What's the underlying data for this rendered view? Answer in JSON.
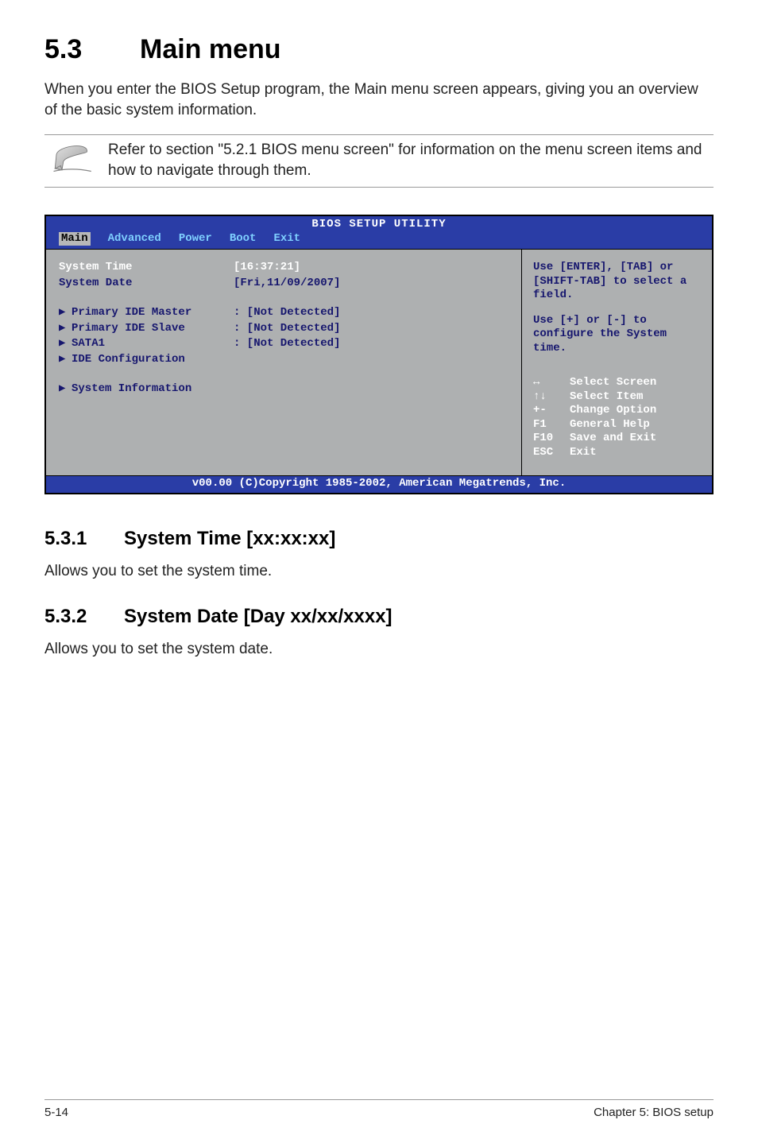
{
  "heading": {
    "number": "5.3",
    "title": "Main menu"
  },
  "intro": "When you enter the BIOS Setup program, the Main menu screen appears, giving you an overview of the basic system information.",
  "note": "Refer to section \"5.2.1  BIOS menu screen\" for information on the menu screen items and how to navigate through them.",
  "bios": {
    "title": "BIOS SETUP UTILITY",
    "tabs": [
      "Main",
      "Advanced",
      "Power",
      "Boot",
      "Exit"
    ],
    "selected_tab": "Main",
    "left": {
      "system_time_label": "System Time",
      "system_time_value": "[16:37:21]",
      "system_date_label": "System Date",
      "system_date_value": "[Fri,11/09/2007]",
      "items": [
        {
          "label": "Primary IDE Master",
          "value": ": [Not Detected]"
        },
        {
          "label": "Primary IDE Slave",
          "value": ": [Not Detected]"
        },
        {
          "label": "SATA1",
          "value": ": [Not Detected]"
        },
        {
          "label": "IDE Configuration",
          "value": ""
        },
        {
          "label": "System Information",
          "value": ""
        }
      ]
    },
    "right": {
      "help1": "Use [ENTER], [TAB] or [SHIFT-TAB] to select a field.",
      "help2": "Use [+] or [-] to configure the System time.",
      "nav": [
        {
          "key": "↔",
          "desc": "Select Screen"
        },
        {
          "key": "↑↓",
          "desc": "Select Item"
        },
        {
          "key": "+-",
          "desc": "Change Option"
        },
        {
          "key": "F1",
          "desc": "General Help"
        },
        {
          "key": "F10",
          "desc": "Save and Exit"
        },
        {
          "key": "ESC",
          "desc": "Exit"
        }
      ]
    },
    "footer": "v00.00 (C)Copyright 1985-2002, American Megatrends, Inc."
  },
  "sub1": {
    "number": "5.3.1",
    "title": "System Time [xx:xx:xx]",
    "body": "Allows you to set the system time."
  },
  "sub2": {
    "number": "5.3.2",
    "title": "System Date [Day xx/xx/xxxx]",
    "body": "Allows you to set the system date."
  },
  "footer": {
    "left": "5-14",
    "right": "Chapter 5: BIOS setup"
  }
}
